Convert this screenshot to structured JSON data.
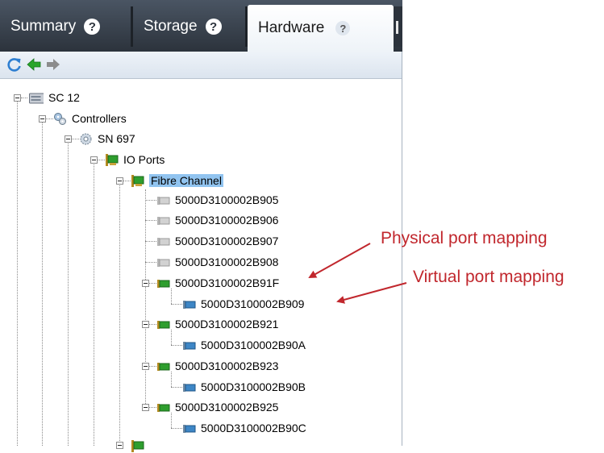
{
  "tabs": [
    {
      "label": "Summary",
      "help": "?"
    },
    {
      "label": "Storage",
      "help": "?"
    },
    {
      "label": "Hardware",
      "help": "?"
    }
  ],
  "toolbar": {
    "refresh": "refresh-icon",
    "back": "back-arrow-icon",
    "forward": "forward-arrow-icon"
  },
  "tree": {
    "root": "SC 12",
    "controllers": "Controllers",
    "controller": "SN 697",
    "io_ports": "IO Ports",
    "fibre_channel": "Fibre Channel",
    "ports": [
      "5000D3100002B905",
      "5000D3100002B906",
      "5000D3100002B907",
      "5000D3100002B908",
      "5000D3100002B91F",
      "5000D3100002B909",
      "5000D3100002B921",
      "5000D3100002B90A",
      "5000D3100002B923",
      "5000D3100002B90B",
      "5000D3100002B925",
      "5000D3100002B90C"
    ]
  },
  "annotations": {
    "physical": "Physical port mapping",
    "virtual": "Virtual port mapping"
  },
  "colors": {
    "callout": "#c1272d",
    "selection": "#91c4f0",
    "tab_bar": "#2c333c"
  }
}
